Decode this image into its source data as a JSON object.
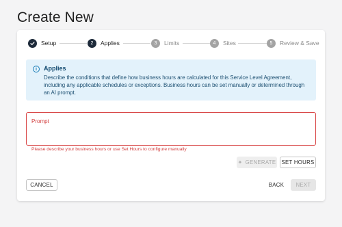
{
  "page": {
    "title": "Create New"
  },
  "stepper": {
    "steps": [
      {
        "number": "1",
        "label": "Setup",
        "state": "done"
      },
      {
        "number": "2",
        "label": "Applies",
        "state": "active"
      },
      {
        "number": "3",
        "label": "Limits",
        "state": "inactive"
      },
      {
        "number": "4",
        "label": "Sites",
        "state": "inactive"
      },
      {
        "number": "5",
        "label": "Review & Save",
        "state": "inactive"
      }
    ]
  },
  "info": {
    "icon": "info-icon",
    "title": "Applies",
    "text": "Describe the conditions that define how business hours are calculated for this Service Level Agreement, including any applicable schedules or exceptions. Business hours can be set manually or determined through an AI prompt."
  },
  "prompt": {
    "label": "Prompt",
    "value": "",
    "error": "Please describe your business hours or use Set Hours to configure manually"
  },
  "actions": {
    "generate_label": "GENERATE",
    "set_hours_label": "SET HOURS",
    "cancel_label": "CANCEL",
    "back_label": "BACK",
    "next_label": "NEXT"
  },
  "colors": {
    "stepper_active": "#1d2a3a",
    "stepper_inactive": "#a3a3a3",
    "info_background": "#e3f2fb",
    "info_accent": "#1c7fb8",
    "error": "#d23c3c"
  }
}
